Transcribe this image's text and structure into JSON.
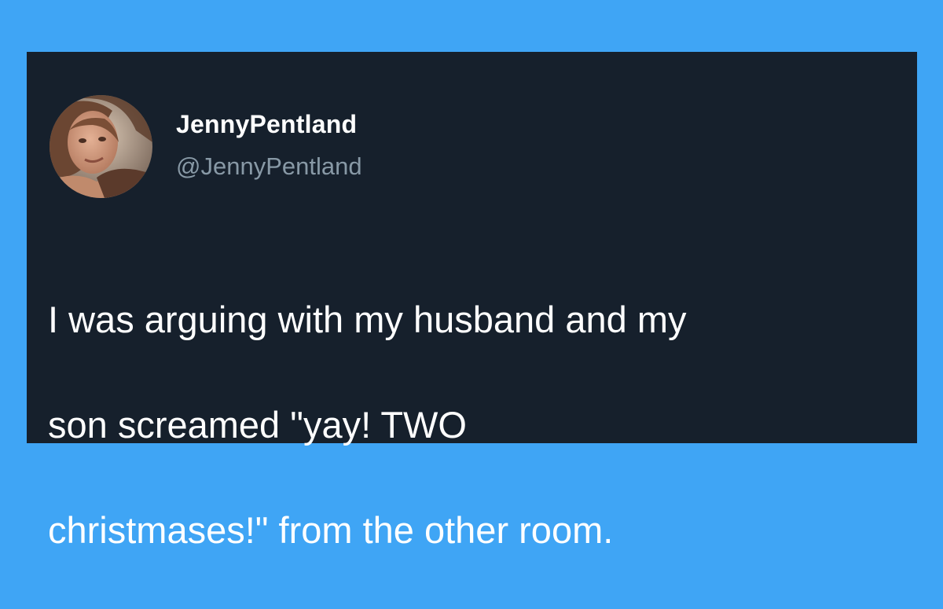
{
  "tweet": {
    "display_name": "JennyPentland",
    "handle": "@JennyPentland",
    "text_lines": [
      "I was arguing with my husband and my",
      "son screamed \"yay! TWO",
      "christmases!\" from the other room."
    ]
  },
  "colors": {
    "page_background": "#3fa5f5",
    "card_background": "#16202c",
    "primary_text": "#ffffff",
    "secondary_text": "#8899a6"
  }
}
